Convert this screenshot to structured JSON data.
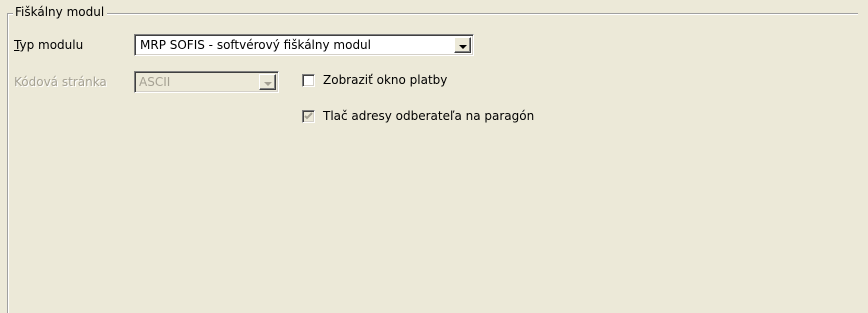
{
  "group": {
    "title": "Fiškálny modul"
  },
  "fields": {
    "module_type": {
      "label_accel": "T",
      "label_rest": "yp modulu",
      "selected": "MRP SOFIS - softvérový fiškálny modul"
    },
    "code_page": {
      "label": "Kódová stránka",
      "selected": "ASCII",
      "disabled": true
    }
  },
  "options": {
    "show_payment_window": {
      "label": "Zobraziť okno platby",
      "checked": false
    },
    "print_customer_address": {
      "label": "Tlač adresy odberateľa na paragón",
      "checked": true,
      "disabled": true
    }
  },
  "colors": {
    "background": "#ece9d8",
    "disabled_text": "#a5a193"
  },
  "icons": {
    "dropdown": "chevron-down-icon",
    "check": "checkmark-icon"
  }
}
